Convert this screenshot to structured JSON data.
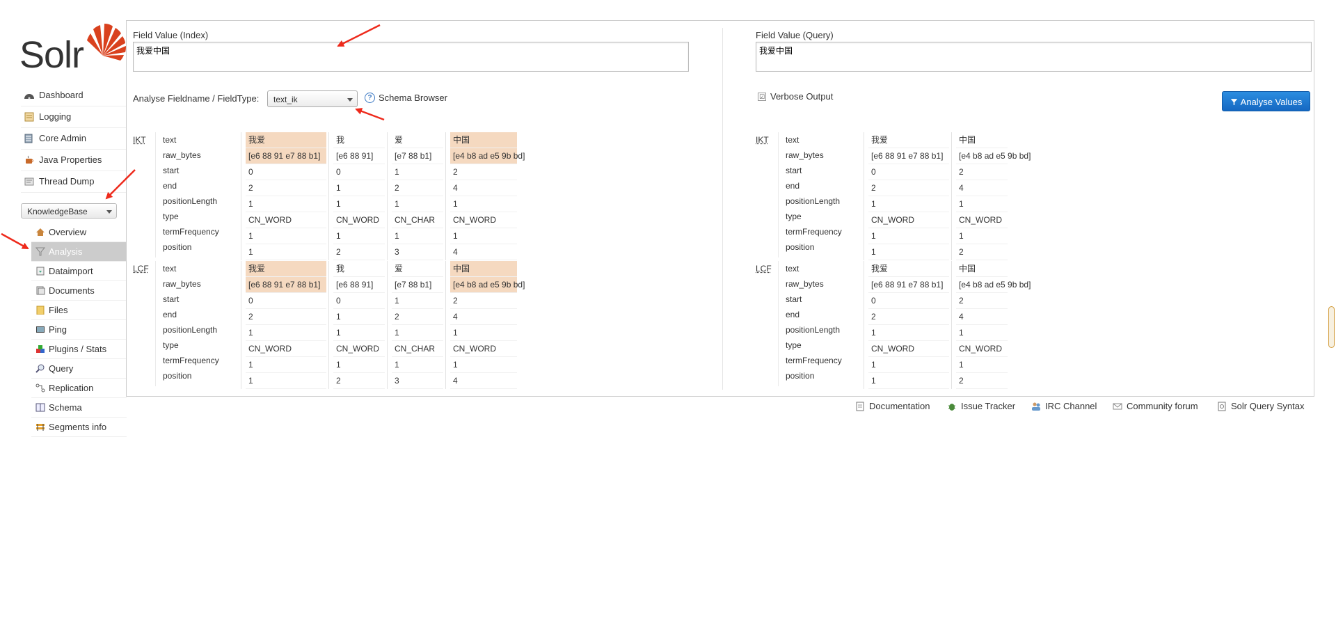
{
  "brand": {
    "name": "Solr",
    "accent": "#d9411e"
  },
  "sidebar": {
    "items": [
      {
        "label": "Dashboard",
        "icon": "dashboard-icon"
      },
      {
        "label": "Logging",
        "icon": "logging-icon"
      },
      {
        "label": "Core Admin",
        "icon": "core-admin-icon"
      },
      {
        "label": "Java Properties",
        "icon": "java-icon"
      },
      {
        "label": "Thread Dump",
        "icon": "thread-dump-icon"
      }
    ],
    "core_selector": "KnowledgeBase",
    "core_items": [
      {
        "label": "Overview",
        "icon": "home-icon"
      },
      {
        "label": "Analysis",
        "icon": "filter-icon",
        "active": true
      },
      {
        "label": "Dataimport",
        "icon": "dataimport-icon"
      },
      {
        "label": "Documents",
        "icon": "documents-icon"
      },
      {
        "label": "Files",
        "icon": "files-icon"
      },
      {
        "label": "Ping",
        "icon": "ping-icon"
      },
      {
        "label": "Plugins / Stats",
        "icon": "plugins-icon"
      },
      {
        "label": "Query",
        "icon": "query-icon"
      },
      {
        "label": "Replication",
        "icon": "replication-icon"
      },
      {
        "label": "Schema",
        "icon": "schema-icon"
      },
      {
        "label": "Segments info",
        "icon": "segments-icon"
      }
    ]
  },
  "analysis": {
    "index_label": "Field Value (Index)",
    "index_value": "我爱中国",
    "query_label": "Field Value (Query)",
    "query_value": "我爱中国",
    "fieldtype_label": "Analyse Fieldname / FieldType:",
    "fieldtype_value": "text_ik",
    "schema_browser": "Schema Browser",
    "verbose_label": "Verbose Output",
    "verbose_check": "☑",
    "analyse_button": "Analyse Values",
    "attributes": [
      "text",
      "raw_bytes",
      "start",
      "end",
      "positionLength",
      "type",
      "termFrequency",
      "position"
    ],
    "index_stages": [
      {
        "name": "IKT",
        "tokens": [
          {
            "values": [
              "我爱",
              "[e6 88 91 e7 88 b1]",
              "0",
              "2",
              "1",
              "CN_WORD",
              "1",
              "1"
            ],
            "highlight": true
          },
          {
            "values": [
              "我",
              "[e6 88 91]",
              "0",
              "1",
              "1",
              "CN_WORD",
              "1",
              "2"
            ],
            "highlight": false
          },
          {
            "values": [
              "爱",
              "[e7 88 b1]",
              "1",
              "2",
              "1",
              "CN_CHAR",
              "1",
              "3"
            ],
            "highlight": false
          },
          {
            "values": [
              "中国",
              "[e4 b8 ad e5 9b bd]",
              "2",
              "4",
              "1",
              "CN_WORD",
              "1",
              "4"
            ],
            "highlight": true
          }
        ]
      },
      {
        "name": "LCF",
        "tokens": [
          {
            "values": [
              "我爱",
              "[e6 88 91 e7 88 b1]",
              "0",
              "2",
              "1",
              "CN_WORD",
              "1",
              "1"
            ],
            "highlight": true
          },
          {
            "values": [
              "我",
              "[e6 88 91]",
              "0",
              "1",
              "1",
              "CN_WORD",
              "1",
              "2"
            ],
            "highlight": false
          },
          {
            "values": [
              "爱",
              "[e7 88 b1]",
              "1",
              "2",
              "1",
              "CN_CHAR",
              "1",
              "3"
            ],
            "highlight": false
          },
          {
            "values": [
              "中国",
              "[e4 b8 ad e5 9b bd]",
              "2",
              "4",
              "1",
              "CN_WORD",
              "1",
              "4"
            ],
            "highlight": true
          }
        ]
      }
    ],
    "query_stages": [
      {
        "name": "IKT",
        "tokens": [
          {
            "values": [
              "我爱",
              "[e6 88 91 e7 88 b1]",
              "0",
              "2",
              "1",
              "CN_WORD",
              "1",
              "1"
            ],
            "highlight": false
          },
          {
            "values": [
              "中国",
              "[e4 b8 ad e5 9b bd]",
              "2",
              "4",
              "1",
              "CN_WORD",
              "1",
              "2"
            ],
            "highlight": false
          }
        ]
      },
      {
        "name": "LCF",
        "tokens": [
          {
            "values": [
              "我爱",
              "[e6 88 91 e7 88 b1]",
              "0",
              "2",
              "1",
              "CN_WORD",
              "1",
              "1"
            ],
            "highlight": false
          },
          {
            "values": [
              "中国",
              "[e4 b8 ad e5 9b bd]",
              "2",
              "4",
              "1",
              "CN_WORD",
              "1",
              "2"
            ],
            "highlight": false
          }
        ]
      }
    ]
  },
  "footer": {
    "links": [
      {
        "label": "Documentation",
        "icon": "document-icon"
      },
      {
        "label": "Issue Tracker",
        "icon": "bug-icon"
      },
      {
        "label": "IRC Channel",
        "icon": "irc-icon"
      },
      {
        "label": "Community forum",
        "icon": "mail-icon"
      },
      {
        "label": "Solr Query Syntax",
        "icon": "query-syntax-icon"
      }
    ]
  },
  "colors": {
    "highlight": "#f5d9c0",
    "button": "#1a73cf",
    "arrow": "#ee2a1c"
  }
}
